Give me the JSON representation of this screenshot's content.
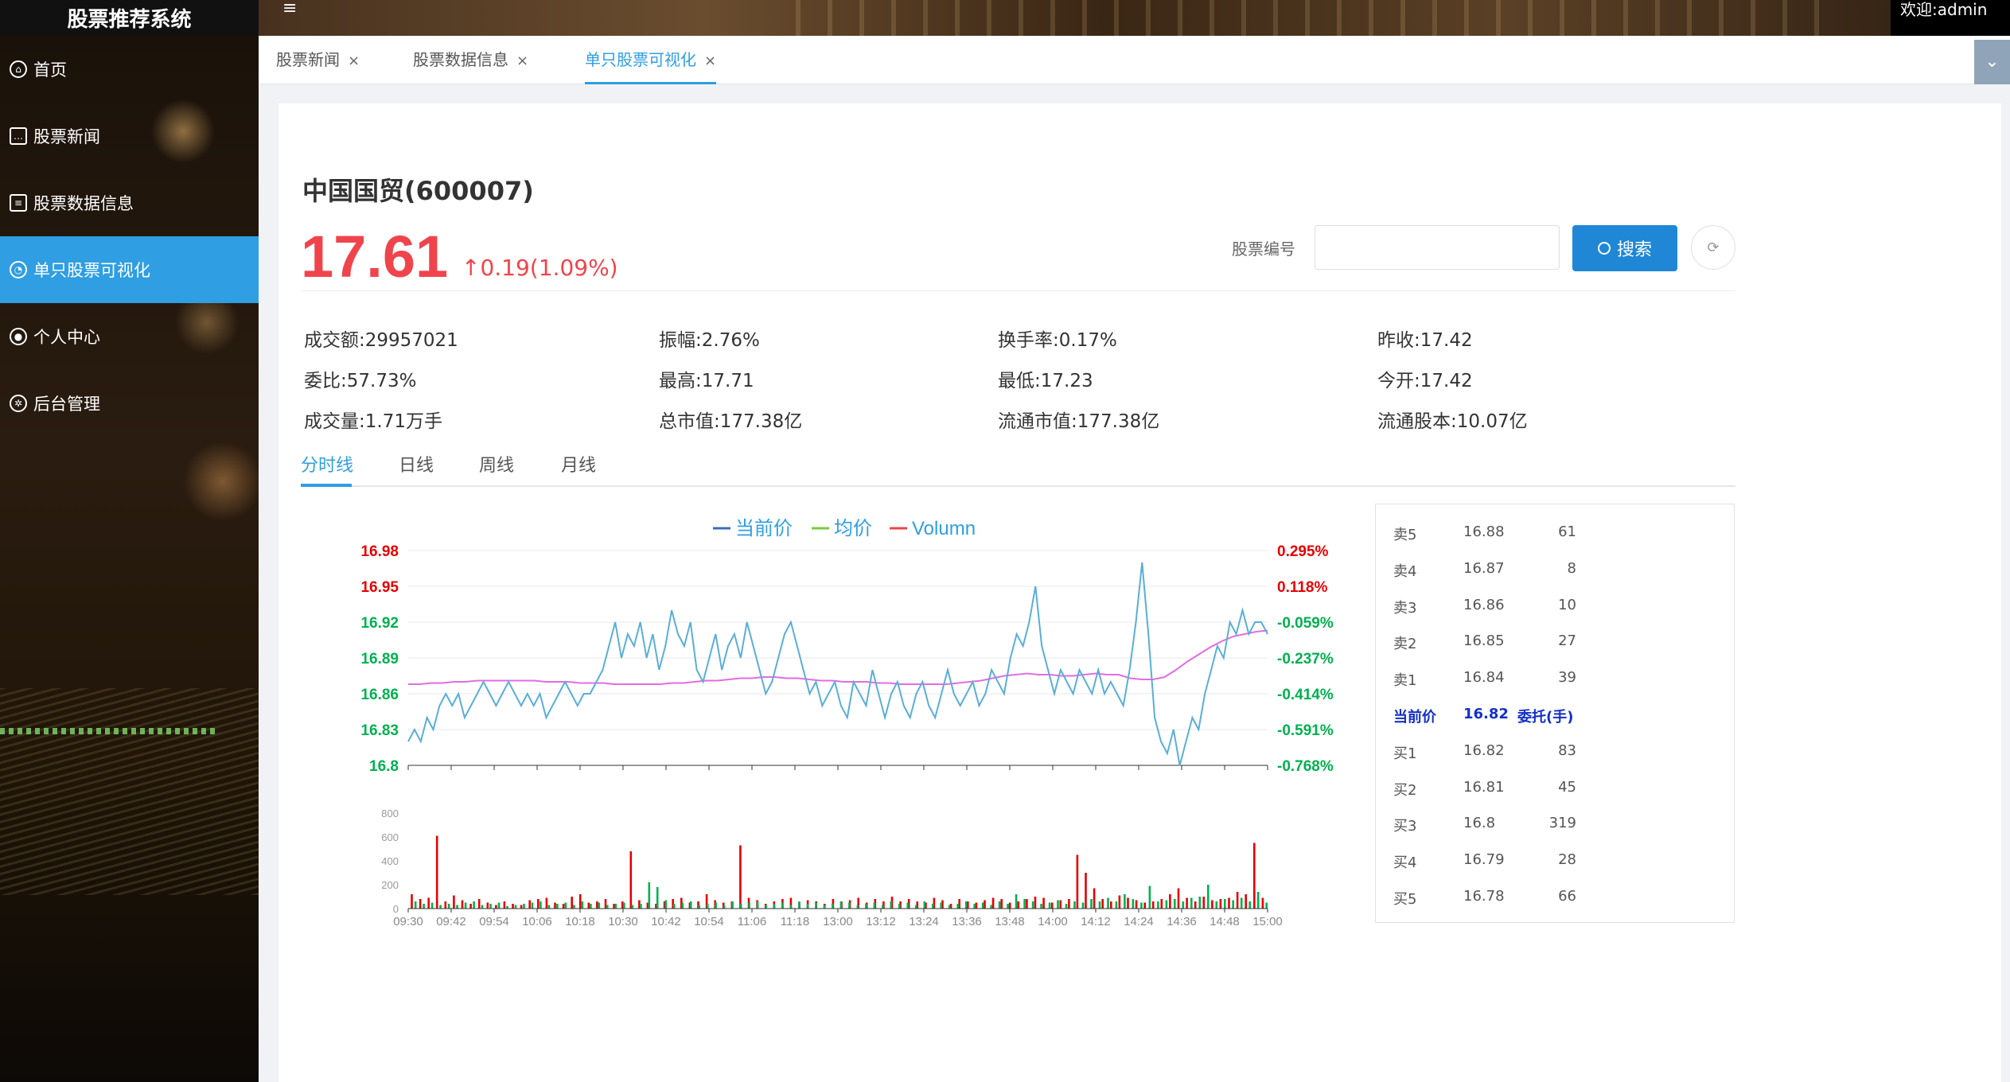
{
  "app": {
    "title": "股票推荐系统",
    "menu_icon": "hamburger-icon",
    "welcome": "欢迎:admin"
  },
  "sidebar": {
    "items": [
      {
        "label": "首页",
        "icon": "home-icon"
      },
      {
        "label": "股票新闻",
        "icon": "message-icon"
      },
      {
        "label": "股票数据信息",
        "icon": "document-icon"
      },
      {
        "label": "单只股票可视化",
        "icon": "dashboard-icon",
        "active": true
      },
      {
        "label": "个人中心",
        "icon": "user-icon"
      },
      {
        "label": "后台管理",
        "icon": "gear-icon"
      }
    ]
  },
  "tabs": [
    {
      "label": "股票新闻",
      "close": "×"
    },
    {
      "label": "股票数据信息",
      "close": "×"
    },
    {
      "label": "单只股票可视化",
      "close": "×",
      "active": true
    }
  ],
  "stock": {
    "name": "中国国贸(600007)",
    "price": "17.61",
    "change": "↑0.19(1.09%)",
    "accent_color": "#f0444c"
  },
  "search": {
    "label": "股票编号",
    "placeholder": "",
    "value": "",
    "button": "搜索"
  },
  "stats": [
    {
      "label": "成交额:",
      "value": "29957021"
    },
    {
      "label": "振幅:",
      "value": "2.76%"
    },
    {
      "label": "换手率:",
      "value": "0.17%"
    },
    {
      "label": "昨收:",
      "value": "17.42"
    },
    {
      "label": "委比:",
      "value": "57.73%"
    },
    {
      "label": "最高:",
      "value": "17.71"
    },
    {
      "label": "最低:",
      "value": "17.23"
    },
    {
      "label": "今开:",
      "value": "17.42"
    },
    {
      "label": "成交量:",
      "value": "1.71万手"
    },
    {
      "label": "总市值:",
      "value": "177.38亿"
    },
    {
      "label": "流通市值:",
      "value": "177.38亿"
    },
    {
      "label": "流通股本:",
      "value": "10.07亿"
    }
  ],
  "chart_tabs": [
    "分时线",
    "日线",
    "周线",
    "月线"
  ],
  "chart_data": {
    "type": "line",
    "legend": [
      {
        "name": "当前价",
        "color": "#3b6fb6"
      },
      {
        "name": "均价",
        "color": "#7ac943"
      },
      {
        "name": "Volumn",
        "color": "#e8474c"
      }
    ],
    "price_ticks": [
      "16.98",
      "16.95",
      "16.92",
      "16.89",
      "16.86",
      "16.83",
      "16.8"
    ],
    "price_tick_colors": [
      "#e60000",
      "#e60000",
      "#00b050",
      "#00b050",
      "#00b050",
      "#00b050",
      "#00b050"
    ],
    "pct_ticks": [
      "0.295%",
      "0.118%",
      "-0.059%",
      "-0.237%",
      "-0.414%",
      "-0.591%",
      "-0.768%"
    ],
    "pct_tick_colors": [
      "#e60000",
      "#e60000",
      "#00b050",
      "#00b050",
      "#00b050",
      "#00b050",
      "#00b050"
    ],
    "ylim": [
      16.8,
      16.98
    ],
    "volume_ticks": [
      "800",
      "600",
      "400",
      "200",
      "0"
    ],
    "volume_ylim": [
      0,
      800
    ],
    "time_ticks": [
      "09:30",
      "09:42",
      "09:54",
      "10:06",
      "10:18",
      "10:30",
      "10:42",
      "10:54",
      "11:06",
      "11:18",
      "13:00",
      "13:12",
      "13:24",
      "13:36",
      "13:48",
      "14:00",
      "14:12",
      "14:24",
      "14:36",
      "14:48",
      "15:00"
    ],
    "price_series": [
      16.82,
      16.83,
      16.82,
      16.84,
      16.83,
      16.85,
      16.86,
      16.85,
      16.86,
      16.84,
      16.85,
      16.86,
      16.87,
      16.86,
      16.85,
      16.86,
      16.87,
      16.86,
      16.85,
      16.86,
      16.85,
      16.86,
      16.84,
      16.85,
      16.86,
      16.87,
      16.86,
      16.85,
      16.86,
      16.86,
      16.87,
      16.88,
      16.9,
      16.92,
      16.89,
      16.91,
      16.9,
      16.92,
      16.89,
      16.91,
      16.88,
      16.9,
      16.93,
      16.91,
      16.9,
      16.92,
      16.88,
      16.87,
      16.89,
      16.91,
      16.88,
      16.9,
      16.91,
      16.89,
      16.92,
      16.9,
      16.88,
      16.86,
      16.87,
      16.89,
      16.91,
      16.92,
      16.9,
      16.88,
      16.86,
      16.87,
      16.85,
      16.86,
      16.87,
      16.85,
      16.84,
      16.87,
      16.86,
      16.85,
      16.88,
      16.86,
      16.84,
      16.86,
      16.87,
      16.85,
      16.84,
      16.86,
      16.87,
      16.85,
      16.84,
      16.86,
      16.88,
      16.86,
      16.85,
      16.86,
      16.87,
      16.85,
      16.86,
      16.88,
      16.87,
      16.86,
      16.89,
      16.91,
      16.9,
      16.92,
      16.95,
      16.9,
      16.88,
      16.86,
      16.88,
      16.87,
      16.86,
      16.88,
      16.87,
      16.86,
      16.88,
      16.86,
      16.87,
      16.86,
      16.85,
      16.88,
      16.92,
      16.97,
      16.91,
      16.84,
      16.82,
      16.81,
      16.83,
      16.8,
      16.82,
      16.84,
      16.83,
      16.86,
      16.88,
      16.9,
      16.89,
      16.92,
      16.91,
      16.93,
      16.91,
      16.92,
      16.92,
      16.91
    ],
    "avg_series": [
      16.868,
      16.868,
      16.869,
      16.869,
      16.87,
      16.87,
      16.871,
      16.871,
      16.871,
      16.871,
      16.871,
      16.871,
      16.87,
      16.87,
      16.87,
      16.869,
      16.869,
      16.869,
      16.868,
      16.868,
      16.868,
      16.868,
      16.868,
      16.869,
      16.869,
      16.87,
      16.871,
      16.871,
      16.872,
      16.873,
      16.873,
      16.874,
      16.874,
      16.873,
      16.873,
      16.872,
      16.871,
      16.871,
      16.87,
      16.87,
      16.87,
      16.869,
      16.869,
      16.868,
      16.868,
      16.868,
      16.868,
      16.868,
      16.869,
      16.87,
      16.871,
      16.873,
      16.875,
      16.876,
      16.877,
      16.876,
      16.876,
      16.875,
      16.875,
      16.876,
      16.877,
      16.876,
      16.876,
      16.873,
      16.872,
      16.872,
      16.874,
      16.88,
      16.887,
      16.893,
      16.899,
      16.904,
      16.908,
      16.91,
      16.912,
      16.913
    ],
    "volume_up": [
      120,
      80,
      90,
      610,
      60,
      110,
      70,
      40,
      80,
      50,
      30,
      60,
      40,
      30,
      70,
      80,
      90,
      50,
      40,
      100,
      120,
      50,
      60,
      80,
      40,
      60,
      480,
      70,
      50,
      40,
      60,
      80,
      90,
      50,
      60,
      120,
      70,
      50,
      60,
      530,
      90,
      70,
      40,
      60,
      80,
      90,
      50,
      70,
      60,
      40,
      80,
      60,
      70,
      90,
      50,
      80,
      60,
      100,
      60,
      80,
      60,
      50,
      90,
      70,
      40,
      80,
      60,
      50,
      70,
      90,
      80,
      50,
      60,
      80,
      100,
      90,
      50,
      70,
      80,
      450,
      300,
      170,
      80,
      60,
      110,
      90,
      70,
      50,
      60,
      80,
      120,
      170,
      90,
      60,
      100,
      70,
      80,
      90,
      140,
      120,
      550,
      90
    ],
    "volume_down": [
      60,
      40,
      50,
      30,
      40,
      30,
      50,
      60,
      30,
      40,
      50,
      20,
      30,
      40,
      50,
      60,
      30,
      40,
      50,
      30,
      60,
      40,
      50,
      30,
      40,
      50,
      30,
      40,
      220,
      180,
      70,
      40,
      50,
      60,
      30,
      40,
      50,
      30,
      60,
      40,
      50,
      60,
      30,
      40,
      50,
      30,
      60,
      40,
      50,
      30,
      40,
      60,
      50,
      30,
      40,
      50,
      30,
      60,
      40,
      50,
      30,
      60,
      40,
      50,
      30,
      40,
      60,
      40,
      50,
      30,
      60,
      40,
      120,
      80,
      60,
      40,
      50,
      70,
      40,
      60,
      50,
      80,
      60,
      90,
      60,
      120,
      80,
      50,
      190,
      60,
      70,
      80,
      60,
      90,
      100,
      200,
      60,
      80,
      70,
      90,
      60,
      140,
      50
    ],
    "color_up": "#e60000",
    "color_down": "#00b050",
    "color_price": "#5aaed8",
    "color_avg": "#e06ee0"
  },
  "orderbook": {
    "rows": [
      {
        "label": "卖5",
        "price": "16.88",
        "volume": "61"
      },
      {
        "label": "卖4",
        "price": "16.87",
        "volume": "8"
      },
      {
        "label": "卖3",
        "price": "16.86",
        "volume": "10"
      },
      {
        "label": "卖2",
        "price": "16.85",
        "volume": "27"
      },
      {
        "label": "卖1",
        "price": "16.84",
        "volume": "39"
      },
      {
        "label": "当前价",
        "price": "16.82",
        "volume": "委托(手)",
        "current": true
      },
      {
        "label": "买1",
        "price": "16.82",
        "volume": "83"
      },
      {
        "label": "买2",
        "price": "16.81",
        "volume": "45"
      },
      {
        "label": "买3",
        "price": "16.8",
        "volume": "319"
      },
      {
        "label": "买4",
        "price": "16.79",
        "volume": "28"
      },
      {
        "label": "买5",
        "price": "16.78",
        "volume": "66"
      }
    ]
  }
}
